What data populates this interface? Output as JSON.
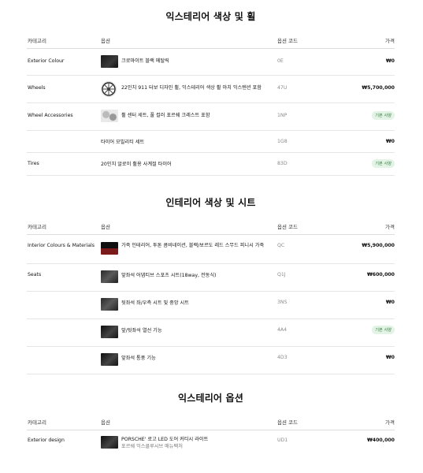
{
  "columns": {
    "category": "카테고리",
    "option": "옵션",
    "code": "옵션 코드",
    "price": "가격"
  },
  "sections": [
    {
      "title": "익스테리어 색상 및 휠",
      "rows": [
        {
          "category": "Exterior Colour",
          "option": "크로마이트 블랙 메탈릭",
          "code": "0E",
          "price": "₩0",
          "thumb": "black-paint-swatch"
        },
        {
          "category": "Wheels",
          "option": "22인치 911 터보 디자인 휠, 익스테리어 색상 휠 아치 익스텐션 포함",
          "code": "47U",
          "price": "₩5,700,000",
          "thumb": "wheel-icon"
        },
        {
          "category": "Wheel Accessories",
          "option": "휠 센터 세트, 풀 컬러 포르쉐 크레스트 포함",
          "code": "1NP",
          "badge": "기본 사양",
          "thumb": "wheel-accessories-image"
        },
        {
          "category": "",
          "option": "타이어 모빌리티 세트",
          "code": "1G8",
          "price": "₩0"
        },
        {
          "category": "Tires",
          "option": "20인치 알로이 휠용 사계절 타이어",
          "code": "83D",
          "badge": "기본 사양"
        }
      ]
    },
    {
      "title": "인테리어 색상 및 시트",
      "rows": [
        {
          "category": "Interior Colours & Materials",
          "option": "가죽 인테리어, 투톤 콤비네이션, 블랙/보르도 레드 스무드 피니시 가죽",
          "code": "QC",
          "price": "₩5,900,000",
          "thumb": "interior-swatch"
        },
        {
          "category": "Seats",
          "option": "앞좌석 어댑티브 스포츠 시트(18way, 전동식)",
          "code": "Q1J",
          "price": "₩600,000",
          "thumb": "seat-image"
        },
        {
          "category": "",
          "option": "뒷좌석 좌/우측 시트 및 중앙 시트",
          "code": "3NS",
          "price": "₩0",
          "thumb": "rear-seat-image"
        },
        {
          "category": "",
          "option": "앞/뒷좌석 열선 기능",
          "code": "4A4",
          "badge": "기본 사양",
          "thumb": "seat-heating-image"
        },
        {
          "category": "",
          "option": "앞좌석 통풍 기능",
          "code": "4D3",
          "price": "₩0",
          "thumb": "seat-ventilation-image"
        }
      ]
    },
    {
      "title": "익스테리어 옵션",
      "rows": [
        {
          "category": "Exterior design",
          "option": "PORSCHE' 로고 LED 도어 커티시 라이트",
          "sub": "포르쉐 익스클루시브 매뉴팩처",
          "code": "UD1",
          "price": "₩400,000",
          "thumb": "door-light-image"
        }
      ]
    }
  ]
}
